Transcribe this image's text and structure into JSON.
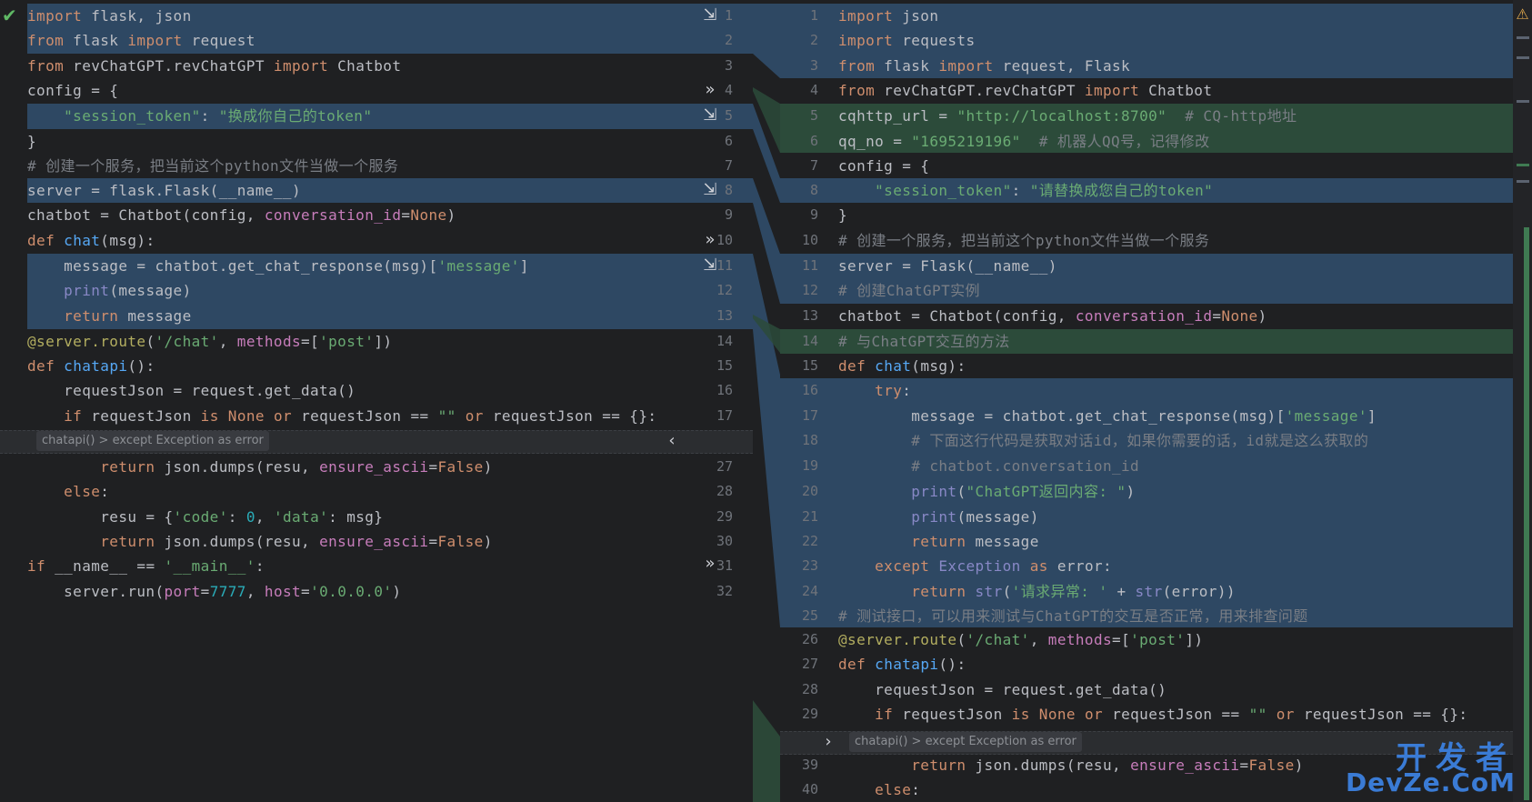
{
  "left": {
    "lines": [
      {
        "n": "1",
        "html": "<span class='kw'>import</span> flask, json"
      },
      {
        "n": "2",
        "html": "<span class='kw'>from</span> flask <span class='kw'>import</span> request"
      },
      {
        "n": "3",
        "html": "<span class='kw'>from</span> revChatGPT.revChatGPT <span class='kw'>import</span> Chatbot"
      },
      {
        "n": "4",
        "html": "config = {"
      },
      {
        "n": "5",
        "html": "    <span class='str'>\"session_token\"</span>: <span class='str'>\"换成你自己的token\"</span>"
      },
      {
        "n": "6",
        "html": "}"
      },
      {
        "n": "7",
        "html": "<span class='cm'># 创建一个服务，把当前这个python文件当做一个服务</span>"
      },
      {
        "n": "8",
        "html": "server = flask.Flask(__name__)"
      },
      {
        "n": "9",
        "html": "chatbot = Chatbot(config, <span class='param'>conversation_id</span>=<span class='kw'>None</span>)"
      },
      {
        "n": "10",
        "html": "<span class='kw'>def</span> <span class='fn'>chat</span>(msg):"
      },
      {
        "n": "11",
        "html": "    message = chatbot.get_chat_response(msg)[<span class='str'>'message'</span>]"
      },
      {
        "n": "12",
        "html": "    <span class='builtin'>print</span>(message)"
      },
      {
        "n": "13",
        "html": "    <span class='kw'>return</span> message"
      },
      {
        "n": "14",
        "html": "<span class='dec'>@server.route</span>(<span class='str'>'/chat'</span>, <span class='param'>methods</span>=[<span class='str'>'post'</span>])"
      },
      {
        "n": "15",
        "html": "<span class='kw'>def</span> <span class='fn'>chatapi</span>():"
      },
      {
        "n": "16",
        "html": "    requestJson = request.get_data()"
      },
      {
        "n": "17",
        "html": "    <span class='kw'>if</span> requestJson <span class='kw'>is</span> <span class='kw'>None</span> <span class='kw'>or</span> requestJson == <span class='str'>\"\"</span> <span class='kw'>or</span> requestJson == {}:"
      },
      {
        "n": "27",
        "html": "        <span class='kw'>return</span> json.dumps(resu, <span class='param'>ensure_ascii</span>=<span class='kw'>False</span>)"
      },
      {
        "n": "28",
        "html": "    <span class='kw'>else</span>:"
      },
      {
        "n": "29",
        "html": "        resu = {<span class='str'>'code'</span>: <span class='num'>0</span>, <span class='str'>'data'</span>: msg}"
      },
      {
        "n": "30",
        "html": "        <span class='kw'>return</span> json.dumps(resu, <span class='param'>ensure_ascii</span>=<span class='kw'>False</span>)"
      },
      {
        "n": "31",
        "html": "<span class='kw'>if</span> __name__ == <span class='str'>'__main__'</span>:"
      },
      {
        "n": "32",
        "html": "    server.run(<span class='param'>port</span>=<span class='num'>7777</span>, <span class='param'>host</span>=<span class='str'>'0.0.0.0'</span>)"
      }
    ],
    "fold_label": "chatapi() > except Exception as error"
  },
  "right": {
    "lines": [
      {
        "n": "1",
        "html": "<span class='kw'>import</span> json"
      },
      {
        "n": "2",
        "html": "<span class='kw'>import</span> requests"
      },
      {
        "n": "3",
        "html": "<span class='kw'>from</span> flask <span class='kw'>import</span> request, Flask"
      },
      {
        "n": "4",
        "html": "<span class='kw'>from</span> revChatGPT.revChatGPT <span class='kw'>import</span> Chatbot"
      },
      {
        "n": "5",
        "html": "cqhttp_url = <span class='str'>\"http://localhost:8700\"</span>  <span class='cm'># CQ-http地址</span>"
      },
      {
        "n": "6",
        "html": "qq_no = <span class='str'>\"1695219196\"</span>  <span class='cm'># 机器人QQ号，记得修改</span>"
      },
      {
        "n": "7",
        "html": "config = {"
      },
      {
        "n": "8",
        "html": "    <span class='str'>\"session_token\"</span>: <span class='str'>\"请替换成您自己的token\"</span>"
      },
      {
        "n": "9",
        "html": "}"
      },
      {
        "n": "10",
        "html": "<span class='cm'># 创建一个服务，把当前这个python文件当做一个服务</span>"
      },
      {
        "n": "11",
        "html": "server = Flask(__name__)"
      },
      {
        "n": "12",
        "html": "<span class='cm'># 创建ChatGPT实例</span>"
      },
      {
        "n": "13",
        "html": "chatbot = Chatbot(config, <span class='param'>conversation_id</span>=<span class='kw'>None</span>)"
      },
      {
        "n": "14",
        "html": "<span class='cm'># 与ChatGPT交互的方法</span>"
      },
      {
        "n": "15",
        "html": "<span class='kw'>def</span> <span class='fn'>chat</span>(msg):"
      },
      {
        "n": "16",
        "html": "    <span class='kw'>try</span>:"
      },
      {
        "n": "17",
        "html": "        message = chatbot.get_chat_response(msg)[<span class='str'>'message'</span>]"
      },
      {
        "n": "18",
        "html": "        <span class='cm'># 下面这行代码是获取对话id，如果你需要的话，id就是这么获取的</span>"
      },
      {
        "n": "19",
        "html": "        <span class='cm'># chatbot.conversation_id</span>"
      },
      {
        "n": "20",
        "html": "        <span class='builtin'>print</span>(<span class='str'>\"ChatGPT返回内容: \"</span>)"
      },
      {
        "n": "21",
        "html": "        <span class='builtin'>print</span>(message)"
      },
      {
        "n": "22",
        "html": "        <span class='kw'>return</span> message"
      },
      {
        "n": "23",
        "html": "    <span class='kw'>except</span> <span class='builtin'>Exception</span> <span class='kw'>as</span> error:"
      },
      {
        "n": "24",
        "html": "        <span class='kw'>return</span> <span class='builtin'>str</span>(<span class='str'>'请求异常: '</span> + <span class='builtin'>str</span>(error))"
      },
      {
        "n": "25",
        "html": "<span class='cm'># 测试接口，可以用来测试与ChatGPT的交互是否正常，用来排查问题</span>"
      },
      {
        "n": "26",
        "html": "<span class='dec'>@server.route</span>(<span class='str'>'/chat'</span>, <span class='param'>methods</span>=[<span class='str'>'post'</span>])"
      },
      {
        "n": "27",
        "html": "<span class='kw'>def</span> <span class='fn'>chatapi</span>():"
      },
      {
        "n": "28",
        "html": "    requestJson = request.get_data()"
      },
      {
        "n": "29",
        "html": "    <span class='kw'>if</span> requestJson <span class='kw'>is</span> <span class='kw'>None</span> <span class='kw'>or</span> requestJson == <span class='str'>\"\"</span> <span class='kw'>or</span> requestJson == {}:"
      },
      {
        "n": "39",
        "html": "        <span class='kw'>return</span> json.dumps(resu, <span class='param'>ensure_ascii</span>=<span class='kw'>False</span>)"
      },
      {
        "n": "40",
        "html": "    <span class='kw'>else</span>:"
      }
    ],
    "fold_label": "chatapi() > except Exception as error"
  },
  "watermark": {
    "top": "开发者",
    "bottom": "DevZe.CoM"
  },
  "icons": {
    "check": "checkmark-icon",
    "warning": "warning-icon",
    "apply": "apply-change-icon",
    "merge": "merge-chevrons-icon",
    "collapse": "fold-arrow-icon"
  },
  "colors": {
    "modified": "#2e4863",
    "added": "#2c4b3a",
    "bg": "#1f2022"
  }
}
